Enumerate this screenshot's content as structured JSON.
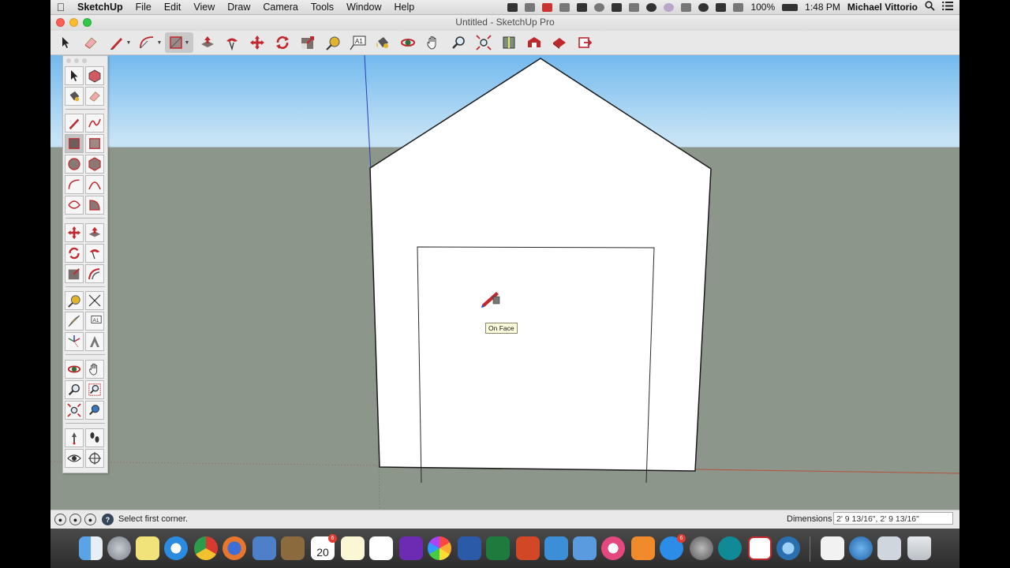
{
  "menubar": {
    "app_name": "SketchUp",
    "items": [
      "File",
      "Edit",
      "View",
      "Draw",
      "Camera",
      "Tools",
      "Window",
      "Help"
    ],
    "battery": "100%",
    "time": "1:48 PM",
    "user": "Michael Vittorio"
  },
  "window": {
    "title": "Untitled - SketchUp Pro"
  },
  "main_toolbar": {
    "tools": [
      "select",
      "eraser",
      "pencil-line",
      "arc",
      "rectangle",
      "push-pull",
      "follow-me",
      "move",
      "rotate",
      "scale",
      "tape-measure",
      "text",
      "paint-bucket",
      "orbit",
      "pan",
      "zoom",
      "zoom-extents",
      "section-plane",
      "3d-warehouse",
      "extension-warehouse",
      "share"
    ],
    "active_tool": "rectangle"
  },
  "viewport": {
    "tooltip": "On Face",
    "colors": {
      "sky_top": "#73b9ee",
      "sky_bottom": "#c6e3f5",
      "ground": "#8d968a",
      "face": "#ffffff",
      "edge": "#1a1a1a"
    }
  },
  "tool_palette": {
    "tools": [
      "select",
      "make-component",
      "paint-bucket",
      "eraser",
      "line",
      "freehand",
      "rectangle",
      "rotated-rectangle",
      "circle",
      "polygon",
      "arc",
      "two-point-arc",
      "three-point-arc",
      "pie",
      "move",
      "push-pull",
      "rotate",
      "follow-me",
      "scale",
      "offset",
      "tape-measure",
      "dimension",
      "protractor",
      "text",
      "axes",
      "3d-text",
      "orbit",
      "pan",
      "zoom",
      "zoom-window",
      "zoom-extents",
      "previous-view",
      "position-camera",
      "walk",
      "look-around",
      "section-plane"
    ],
    "active_tool": "rectangle"
  },
  "statusbar": {
    "message": "Select first corner.",
    "dimensions_label": "Dimensions",
    "dimensions_value": "2' 9 13/16\", 2' 9 13/16\""
  },
  "dock": {
    "calendar_day": "20",
    "calendar_badge": "6",
    "appstore_badge": "6"
  }
}
